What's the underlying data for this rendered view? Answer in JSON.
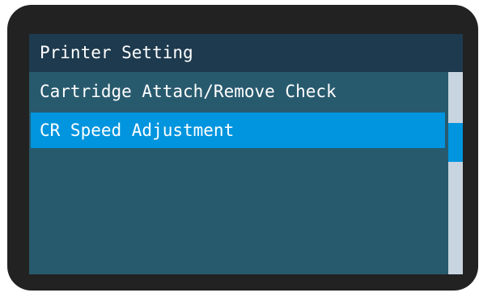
{
  "screen": {
    "title": "Printer Setting"
  },
  "menu": {
    "items": [
      {
        "label": "Cartridge Attach/Remove Check",
        "selected": false
      },
      {
        "label": "CR Speed Adjustment",
        "selected": true
      }
    ]
  },
  "scrollbar": {
    "position_fraction": 0.25,
    "visible_fraction": 0.19
  },
  "colors": {
    "bezel": "#222222",
    "title_bar": "#1e3a4e",
    "screen_bg": "#285a6e",
    "selection": "#0095de",
    "scroll_track": "#c8d4e0",
    "text": "#ffffff"
  }
}
